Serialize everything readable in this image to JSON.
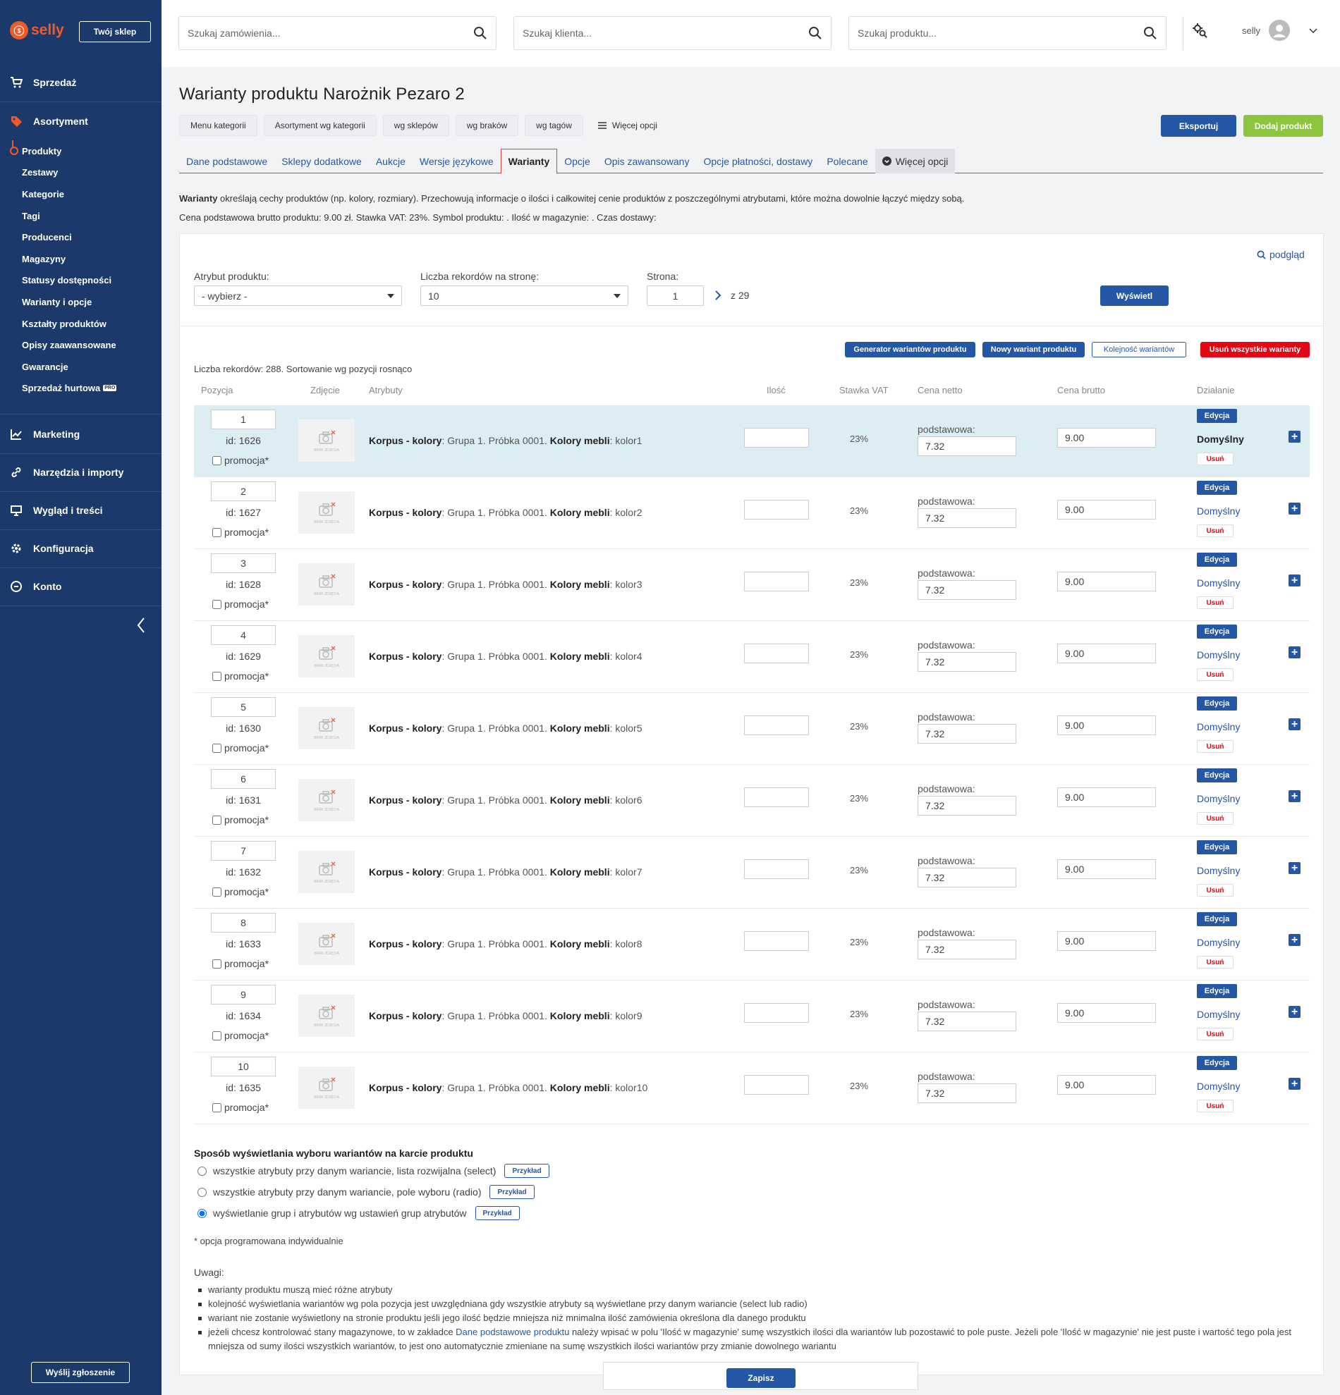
{
  "sidebar": {
    "logo_text": "selly",
    "shop_button": "Twój sklep",
    "sections": [
      {
        "label": "Sprzedaż"
      },
      {
        "label": "Asortyment"
      },
      {
        "label": "Marketing"
      },
      {
        "label": "Narzędzia i importy"
      },
      {
        "label": "Wygląd i treści"
      },
      {
        "label": "Konfiguracja"
      },
      {
        "label": "Konto"
      }
    ],
    "subitems": [
      "Produkty",
      "Zestawy",
      "Kategorie",
      "Tagi",
      "Producenci",
      "Magazyny",
      "Statusy dostępności",
      "Warianty i opcje",
      "Kształty produktów",
      "Opisy zaawansowane",
      "Gwarancje",
      "Sprzedaż hurtowa"
    ],
    "pro_badge": "PRO",
    "report_button": "Wyślij zgłoszenie",
    "accent_color": "#f05a28",
    "bg_color": "#1b3a6b"
  },
  "topbar": {
    "search_orders": "Szukaj zamówienia...",
    "search_clients": "Szukaj klienta...",
    "search_products": "Szukaj produktu...",
    "username": "selly"
  },
  "page": {
    "title": "Warianty produktu Narożnik Pezaro 2",
    "cat_buttons": [
      "Menu kategorii",
      "Asortyment wg kategorii",
      "wg sklepów",
      "wg braków",
      "wg tagów"
    ],
    "more_options": "Więcej opcji",
    "export": "Eksportuj",
    "add_product": "Dodaj produkt",
    "tabs": [
      "Dane podstawowe",
      "Sklepy dodatkowe",
      "Aukcje",
      "Wersje językowe",
      "Warianty",
      "Opcje",
      "Opis zawansowany",
      "Opcje płatności, dostawy",
      "Polecane",
      "Więcej opcji"
    ],
    "desc_bold": "Warianty",
    "desc_rest": " określają cechy produktów (np. kolory, rozmiary). Przechowują informacje o ilości i całkowitej cenie produktów z poszczególnymi atrybutami, które można dowolnie łączyć między sobą.",
    "desc2": "Cena podstawowa brutto produktu: 9.00 zł. Stawka VAT: 23%. Symbol produktu: . Ilość w magazynie: . Czas dostawy:"
  },
  "filters": {
    "preview": "podgląd",
    "attr_label": "Atrybut produktu:",
    "attr_value": "- wybierz -",
    "per_page_label": "Liczba rekordów na stronę:",
    "per_page_value": "10",
    "page_label": "Strona:",
    "page_value": "1",
    "page_total": "z 29",
    "show_button": "Wyświetl"
  },
  "actions": {
    "generator": "Generator wariantów produktu",
    "new_variant": "Nowy wariant produktu",
    "order": "Kolejność wariantów",
    "delete_all": "Usuń wszystkie warianty"
  },
  "table": {
    "records_info": "Liczba rekordów: 288. Sortowanie wg pozycji rosnąco",
    "headers": [
      "Pozycja",
      "Zdjęcie",
      "Atrybuty",
      "Ilość",
      "Stawka VAT",
      "Cena netto",
      "Cena brutto",
      "Działanie"
    ],
    "promo_label": "promocja*",
    "netto_label": "podstawowa:",
    "edit_label": "Edycja",
    "default_label": "Domyślny",
    "delete_label": "Usuń",
    "attr_k1": "Korpus - kolory",
    "attr_v1_prefix": ": Grupa 1. Próbka 0001. ",
    "attr_k2": "Kolory mebli",
    "no_photo": "BRAK ZDJĘCIA",
    "rows": [
      {
        "pos": "1",
        "id": "id: 1626",
        "color": ": kolor1",
        "vat": "23%",
        "netto": "7.32",
        "brutto": "9.00",
        "is_default": true
      },
      {
        "pos": "2",
        "id": "id: 1627",
        "color": ": kolor2",
        "vat": "23%",
        "netto": "7.32",
        "brutto": "9.00",
        "is_default": false
      },
      {
        "pos": "3",
        "id": "id: 1628",
        "color": ": kolor3",
        "vat": "23%",
        "netto": "7.32",
        "brutto": "9.00",
        "is_default": false
      },
      {
        "pos": "4",
        "id": "id: 1629",
        "color": ": kolor4",
        "vat": "23%",
        "netto": "7.32",
        "brutto": "9.00",
        "is_default": false
      },
      {
        "pos": "5",
        "id": "id: 1630",
        "color": ": kolor5",
        "vat": "23%",
        "netto": "7.32",
        "brutto": "9.00",
        "is_default": false
      },
      {
        "pos": "6",
        "id": "id: 1631",
        "color": ": kolor6",
        "vat": "23%",
        "netto": "7.32",
        "brutto": "9.00",
        "is_default": false
      },
      {
        "pos": "7",
        "id": "id: 1632",
        "color": ": kolor7",
        "vat": "23%",
        "netto": "7.32",
        "brutto": "9.00",
        "is_default": false
      },
      {
        "pos": "8",
        "id": "id: 1633",
        "color": ": kolor8",
        "vat": "23%",
        "netto": "7.32",
        "brutto": "9.00",
        "is_default": false
      },
      {
        "pos": "9",
        "id": "id: 1634",
        "color": ": kolor9",
        "vat": "23%",
        "netto": "7.32",
        "brutto": "9.00",
        "is_default": false
      },
      {
        "pos": "10",
        "id": "id: 1635",
        "color": ": kolor10",
        "vat": "23%",
        "netto": "7.32",
        "brutto": "9.00",
        "is_default": false
      }
    ]
  },
  "display": {
    "title": "Sposób wyświetlania wyboru wariantów na karcie produktu",
    "options": [
      {
        "label": "wszystkie atrybuty przy danym wariancie, lista rozwijalna (select)",
        "checked": false
      },
      {
        "label": "wszystkie atrybuty przy danym wariancie, pole wyboru (radio)",
        "checked": false
      },
      {
        "label": "wyświetlanie grup i atrybutów wg ustawień grup atrybutów",
        "checked": true
      }
    ],
    "example": "Przykład",
    "footnote": "* opcja programowana indywidualnie"
  },
  "notes": {
    "title": "Uwagi:",
    "items": [
      "warianty produktu muszą mieć różne atrybuty",
      "kolejność wyświetlania wariantów wg pola pozycja jest uwzględniana gdy wszystkie atrybuty są wyświetlane przy danym wariancie (select lub radio)",
      "wariant nie zostanie wyświetlony na stronie produktu jeśli jego ilość będzie mniejsza niż mnimalna ilość zamówienia określona dla danego produktu"
    ],
    "last_prefix": "jeżeli chcesz kontrolować stany magazynowe, to w zakładce ",
    "last_link": "Dane podstawowe produktu",
    "last_suffix": " należy wpisać w polu 'Ilość w magazynie' sumę wszystkich ilości dla wariantów lub pozostawić to pole puste. Jeżeli pole 'Ilość w magazynie' nie jest puste i wartość tego pola jest mniejsza od sumy ilości wszystkich wariantów, to jest ono automatycznie zmieniane na sumę wszystkich ilości wariantów przy zmianie dowolnego wariantu"
  },
  "save_button": "Zapisz"
}
